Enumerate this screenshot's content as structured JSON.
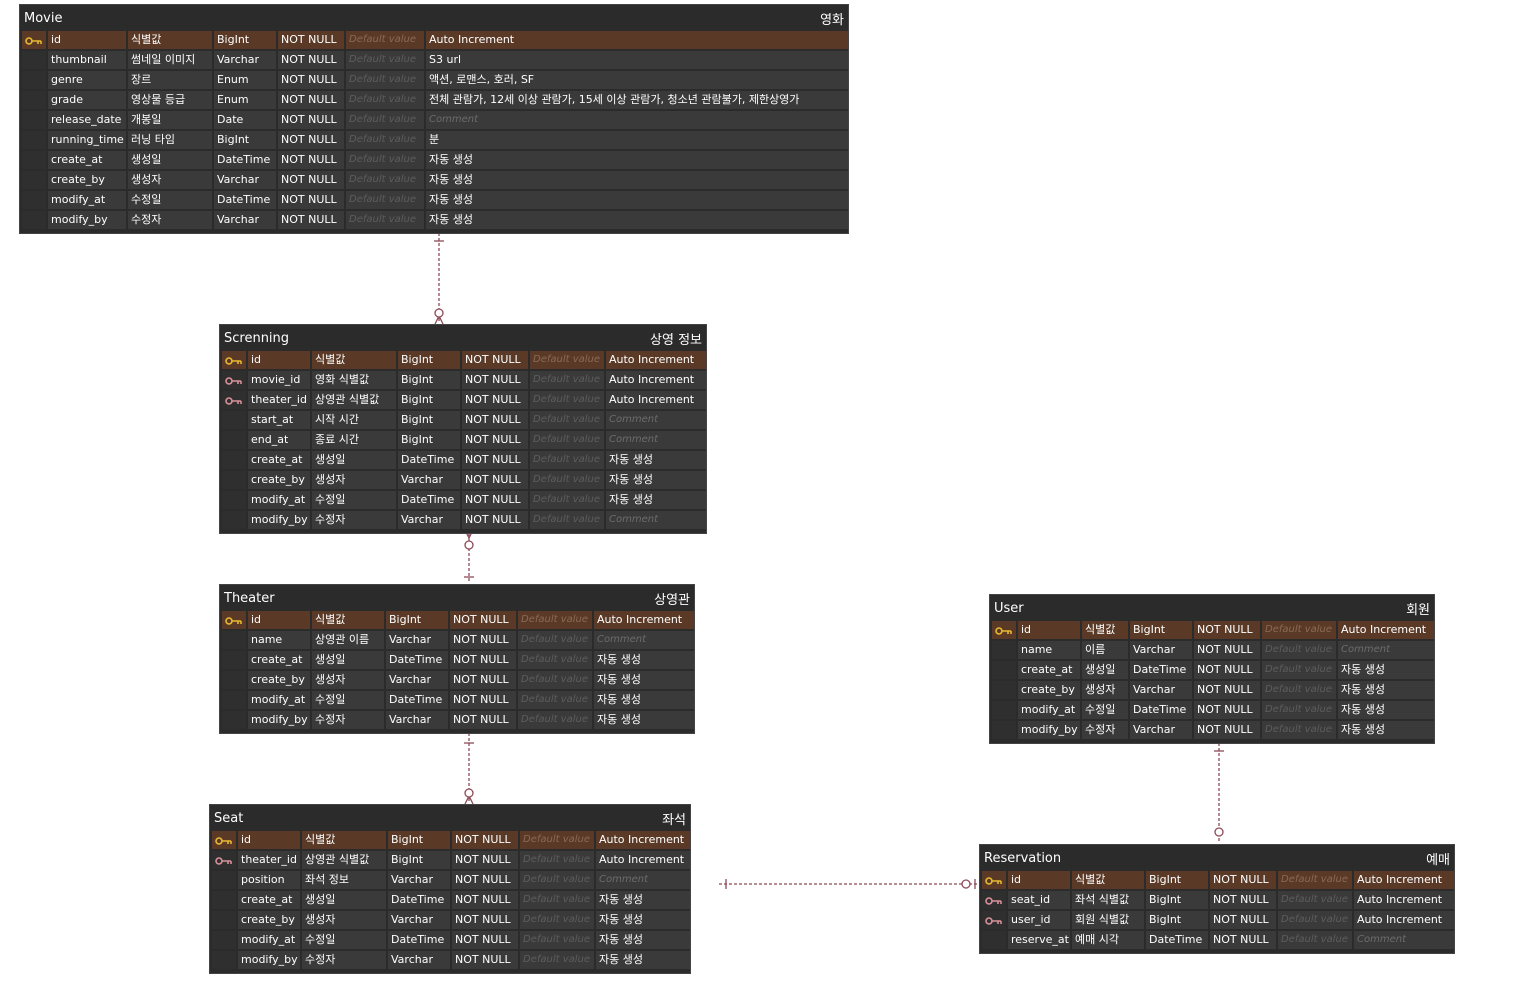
{
  "colors": {
    "background": "#ffffff",
    "entity_bg": "#2b2b2b",
    "cell_bg": "#3a3a3a",
    "pk_row_bg": "#5a3a26",
    "primary_key_icon": "#e8b830",
    "foreign_key_icon": "#d9909a",
    "connector": "#8e4a58"
  },
  "entities": [
    {
      "name": "Movie",
      "label": "영화",
      "rows": [
        {
          "key": "primary",
          "field": "id",
          "desc": "식별값",
          "type": "BigInt",
          "nullable": "NOT NULL",
          "default": "Default value",
          "comment": "Auto Increment"
        },
        {
          "key": "",
          "field": "thumbnail",
          "desc": "썸네일 이미지",
          "type": "Varchar",
          "nullable": "NOT NULL",
          "default": "Default value",
          "comment": "S3 url"
        },
        {
          "key": "",
          "field": "genre",
          "desc": "장르",
          "type": "Enum",
          "nullable": "NOT NULL",
          "default": "Default value",
          "comment": "액션, 로맨스, 호러, SF"
        },
        {
          "key": "",
          "field": "grade",
          "desc": "영상물 등급",
          "type": "Enum",
          "nullable": "NOT NULL",
          "default": "Default value",
          "comment": "전체 관람가, 12세 이상 관람가, 15세 이상 관람가, 청소년 관람불가, 제한상영가"
        },
        {
          "key": "",
          "field": "release_date",
          "desc": "개봉일",
          "type": "Date",
          "nullable": "NOT NULL",
          "default": "Default value",
          "comment": ""
        },
        {
          "key": "",
          "field": "running_time",
          "desc": "러닝 타임",
          "type": "BigInt",
          "nullable": "NOT NULL",
          "default": "Default value",
          "comment": "분"
        },
        {
          "key": "",
          "field": "create_at",
          "desc": "생성일",
          "type": "DateTime",
          "nullable": "NOT NULL",
          "default": "Default value",
          "comment": "자동 생성"
        },
        {
          "key": "",
          "field": "create_by",
          "desc": "생성자",
          "type": "Varchar",
          "nullable": "NOT NULL",
          "default": "Default value",
          "comment": "자동 생성"
        },
        {
          "key": "",
          "field": "modify_at",
          "desc": "수정일",
          "type": "DateTime",
          "nullable": "NOT NULL",
          "default": "Default value",
          "comment": "자동 생성"
        },
        {
          "key": "",
          "field": "modify_by",
          "desc": "수정자",
          "type": "Varchar",
          "nullable": "NOT NULL",
          "default": "Default value",
          "comment": "자동 생성"
        }
      ]
    },
    {
      "name": "Screnning",
      "label": "상영 정보",
      "rows": [
        {
          "key": "primary",
          "field": "id",
          "desc": "식별값",
          "type": "BigInt",
          "nullable": "NOT NULL",
          "default": "Default value",
          "comment": "Auto Increment"
        },
        {
          "key": "foreign",
          "field": "movie_id",
          "desc": "영화 식별값",
          "type": "BigInt",
          "nullable": "NOT NULL",
          "default": "Default value",
          "comment": "Auto Increment"
        },
        {
          "key": "foreign",
          "field": "theater_id",
          "desc": "상영관 식별값",
          "type": "BigInt",
          "nullable": "NOT NULL",
          "default": "Default value",
          "comment": "Auto Increment"
        },
        {
          "key": "",
          "field": "start_at",
          "desc": "시작 시간",
          "type": "BigInt",
          "nullable": "NOT NULL",
          "default": "Default value",
          "comment": ""
        },
        {
          "key": "",
          "field": "end_at",
          "desc": "종료 시간",
          "type": "BigInt",
          "nullable": "NOT NULL",
          "default": "Default value",
          "comment": ""
        },
        {
          "key": "",
          "field": "create_at",
          "desc": "생성일",
          "type": "DateTime",
          "nullable": "NOT NULL",
          "default": "Default value",
          "comment": "자동 생성"
        },
        {
          "key": "",
          "field": "create_by",
          "desc": "생성자",
          "type": "Varchar",
          "nullable": "NOT NULL",
          "default": "Default value",
          "comment": "자동 생성"
        },
        {
          "key": "",
          "field": "modify_at",
          "desc": "수정일",
          "type": "DateTime",
          "nullable": "NOT NULL",
          "default": "Default value",
          "comment": "자동 생성"
        },
        {
          "key": "",
          "field": "modify_by",
          "desc": "수정자",
          "type": "Varchar",
          "nullable": "NOT NULL",
          "default": "Default value",
          "comment": ""
        }
      ]
    },
    {
      "name": "Theater",
      "label": "상영관",
      "rows": [
        {
          "key": "primary",
          "field": "id",
          "desc": "식별값",
          "type": "BigInt",
          "nullable": "NOT NULL",
          "default": "Default value",
          "comment": "Auto Increment"
        },
        {
          "key": "",
          "field": "name",
          "desc": "상영관 이름",
          "type": "Varchar",
          "nullable": "NOT NULL",
          "default": "Default value",
          "comment": ""
        },
        {
          "key": "",
          "field": "create_at",
          "desc": "생성일",
          "type": "DateTime",
          "nullable": "NOT NULL",
          "default": "Default value",
          "comment": "자동 생성"
        },
        {
          "key": "",
          "field": "create_by",
          "desc": "생성자",
          "type": "Varchar",
          "nullable": "NOT NULL",
          "default": "Default value",
          "comment": "자동 생성"
        },
        {
          "key": "",
          "field": "modify_at",
          "desc": "수정일",
          "type": "DateTime",
          "nullable": "NOT NULL",
          "default": "Default value",
          "comment": "자동 생성"
        },
        {
          "key": "",
          "field": "modify_by",
          "desc": "수정자",
          "type": "Varchar",
          "nullable": "NOT NULL",
          "default": "Default value",
          "comment": "자동 생성"
        }
      ]
    },
    {
      "name": "Seat",
      "label": "좌석",
      "rows": [
        {
          "key": "primary",
          "field": "id",
          "desc": "식별값",
          "type": "BigInt",
          "nullable": "NOT NULL",
          "default": "Default value",
          "comment": "Auto Increment"
        },
        {
          "key": "foreign",
          "field": "theater_id",
          "desc": "상영관 식별값",
          "type": "BigInt",
          "nullable": "NOT NULL",
          "default": "Default value",
          "comment": "Auto Increment"
        },
        {
          "key": "",
          "field": "position",
          "desc": "좌석 정보",
          "type": "Varchar",
          "nullable": "NOT NULL",
          "default": "Default value",
          "comment": ""
        },
        {
          "key": "",
          "field": "create_at",
          "desc": "생성일",
          "type": "DateTime",
          "nullable": "NOT NULL",
          "default": "Default value",
          "comment": "자동 생성"
        },
        {
          "key": "",
          "field": "create_by",
          "desc": "생성자",
          "type": "Varchar",
          "nullable": "NOT NULL",
          "default": "Default value",
          "comment": "자동 생성"
        },
        {
          "key": "",
          "field": "modify_at",
          "desc": "수정일",
          "type": "DateTime",
          "nullable": "NOT NULL",
          "default": "Default value",
          "comment": "자동 생성"
        },
        {
          "key": "",
          "field": "modify_by",
          "desc": "수정자",
          "type": "Varchar",
          "nullable": "NOT NULL",
          "default": "Default value",
          "comment": "자동 생성"
        }
      ]
    },
    {
      "name": "User",
      "label": "회원",
      "rows": [
        {
          "key": "primary",
          "field": "id",
          "desc": "식별값",
          "type": "BigInt",
          "nullable": "NOT NULL",
          "default": "Default value",
          "comment": "Auto Increment"
        },
        {
          "key": "",
          "field": "name",
          "desc": "이름",
          "type": "Varchar",
          "nullable": "NOT NULL",
          "default": "Default value",
          "comment": ""
        },
        {
          "key": "",
          "field": "create_at",
          "desc": "생성일",
          "type": "DateTime",
          "nullable": "NOT NULL",
          "default": "Default value",
          "comment": "자동 생성"
        },
        {
          "key": "",
          "field": "create_by",
          "desc": "생성자",
          "type": "Varchar",
          "nullable": "NOT NULL",
          "default": "Default value",
          "comment": "자동 생성"
        },
        {
          "key": "",
          "field": "modify_at",
          "desc": "수정일",
          "type": "DateTime",
          "nullable": "NOT NULL",
          "default": "Default value",
          "comment": "자동 생성"
        },
        {
          "key": "",
          "field": "modify_by",
          "desc": "수정자",
          "type": "Varchar",
          "nullable": "NOT NULL",
          "default": "Default value",
          "comment": "자동 생성"
        }
      ]
    },
    {
      "name": "Reservation",
      "label": "예매",
      "rows": [
        {
          "key": "primary",
          "field": "id",
          "desc": "식별값",
          "type": "BigInt",
          "nullable": "NOT NULL",
          "default": "Default value",
          "comment": "Auto Increment"
        },
        {
          "key": "foreign",
          "field": "seat_id",
          "desc": "좌석 식별값",
          "type": "BigInt",
          "nullable": "NOT NULL",
          "default": "Default value",
          "comment": "Auto Increment"
        },
        {
          "key": "foreign",
          "field": "user_id",
          "desc": "회원 식별값",
          "type": "BigInt",
          "nullable": "NOT NULL",
          "default": "Default value",
          "comment": "Auto Increment"
        },
        {
          "key": "",
          "field": "reserve_at",
          "desc": "예매 시각",
          "type": "DateTime",
          "nullable": "NOT NULL",
          "default": "Default value",
          "comment": ""
        }
      ]
    }
  ],
  "comment_placeholder": "Comment",
  "relations": [
    {
      "from": "Movie",
      "to": "Screnning",
      "from_end": "one",
      "to_end": "zero-or-many"
    },
    {
      "from": "Theater",
      "to": "Screnning",
      "from_end": "one",
      "to_end": "zero-or-many"
    },
    {
      "from": "Theater",
      "to": "Seat",
      "from_end": "one",
      "to_end": "zero-or-many"
    },
    {
      "from": "User",
      "to": "Reservation",
      "from_end": "one",
      "to_end": "zero-or-one"
    },
    {
      "from": "Seat",
      "to": "Reservation",
      "from_end": "one",
      "to_end": "zero-or-one"
    }
  ]
}
